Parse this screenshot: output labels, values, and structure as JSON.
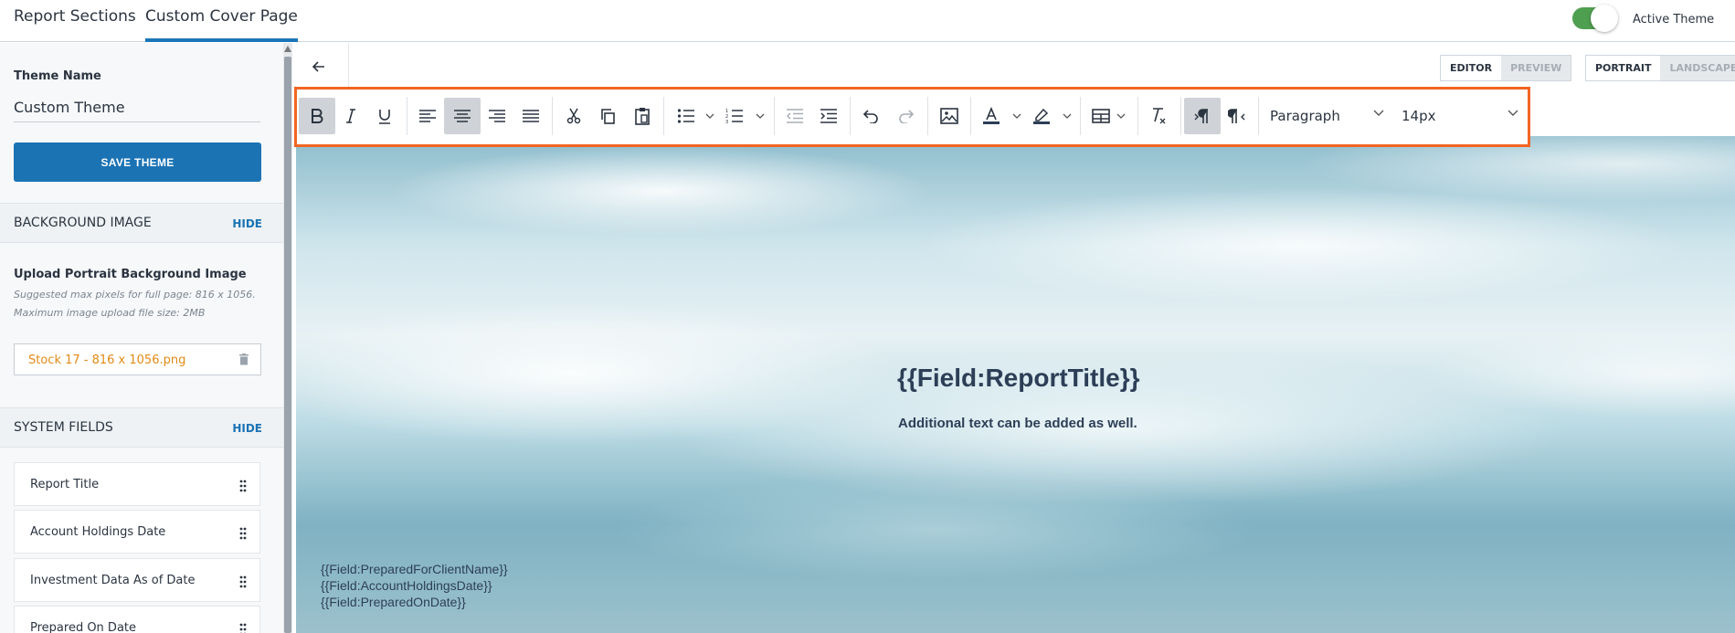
{
  "tabs": [
    {
      "label": "Report Sections"
    },
    {
      "label": "Custom Cover Page"
    }
  ],
  "active_theme": {
    "label": "Active Theme",
    "on": true
  },
  "left_panel": {
    "theme_name_label": "Theme Name",
    "theme_name_value": "Custom Theme",
    "save_button": "SAVE THEME",
    "background_section": {
      "title": "BACKGROUND IMAGE",
      "hide": "HIDE"
    },
    "upload": {
      "title": "Upload Portrait Background Image",
      "hint1": "Suggested max pixels for full page: 816 x 1056.",
      "hint2": "Maximum image upload file size: 2MB",
      "file_name": "Stock 17 - 816 x 1056.png"
    },
    "system_fields_section": {
      "title": "SYSTEM FIELDS",
      "hide": "HIDE"
    },
    "system_fields": [
      "Report Title",
      "Account Holdings Date",
      "Investment Data As of Date",
      "Prepared On Date"
    ]
  },
  "view_toggle": {
    "editor": "EDITOR",
    "preview": "PREVIEW",
    "selected": "EDITOR"
  },
  "orientation_toggle": {
    "portrait": "PORTRAIT",
    "landscape": "LANDSCAPE",
    "selected": "PORTRAIT"
  },
  "toolbar": {
    "block_format": "Paragraph",
    "font_size": "14px",
    "active_buttons": [
      "bold",
      "align-center",
      "ltr"
    ]
  },
  "canvas": {
    "title": "{{Field:ReportTitle}}",
    "subtitle": "Additional text can be added as well.",
    "fields": [
      "{{Field:PreparedForClientName}}",
      "{{Field:AccountHoldingsDate}}",
      "{{Field:PreparedOnDate}}"
    ]
  },
  "colors": {
    "accent": "#1b73b4",
    "toolbar_highlight": "#f26522",
    "toggle_on": "#4f9f50",
    "file_name": "#e28a16"
  }
}
